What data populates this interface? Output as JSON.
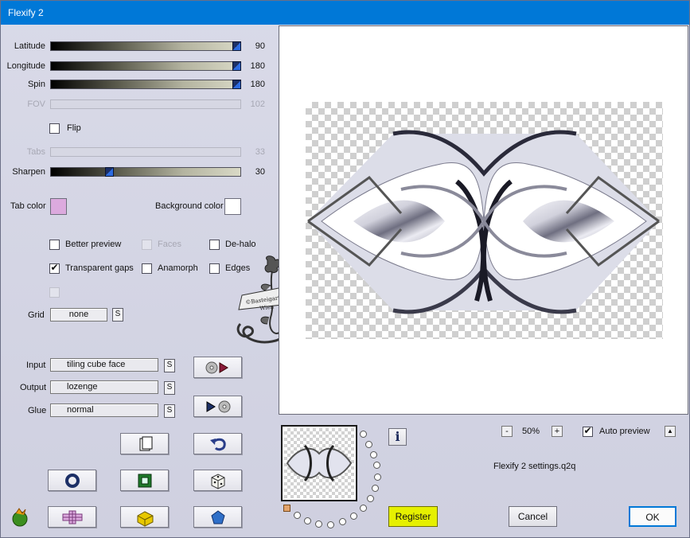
{
  "window": {
    "title": "Flexify 2"
  },
  "sliders": {
    "latitude": {
      "label": "Latitude",
      "value": "90",
      "fraction": 1.0
    },
    "longitude": {
      "label": "Longitude",
      "value": "180",
      "fraction": 1.0
    },
    "spin": {
      "label": "Spin",
      "value": "180",
      "fraction": 1.0
    },
    "fov": {
      "label": "FOV",
      "value": "102",
      "disabled": true
    },
    "tabs": {
      "label": "Tabs",
      "value": "33",
      "disabled": true
    },
    "sharpen": {
      "label": "Sharpen",
      "value": "30",
      "fraction": 0.3
    }
  },
  "options": {
    "flip": {
      "label": "Flip",
      "checked": false
    },
    "better_preview": {
      "label": "Better preview",
      "checked": false
    },
    "faces": {
      "label": "Faces",
      "checked": false,
      "disabled": true
    },
    "de_halo": {
      "label": "De-halo",
      "checked": false
    },
    "transparent_gaps": {
      "label": "Transparent gaps",
      "checked": true
    },
    "anamorph": {
      "label": "Anamorph",
      "checked": false
    },
    "edges": {
      "label": "Edges",
      "checked": false
    }
  },
  "colors": {
    "tab_color_label": "Tab color",
    "tab_color": "#dcaade",
    "background_color_label": "Background color",
    "background_color": "#ffffff"
  },
  "grid": {
    "label": "Grid",
    "value": "none",
    "s_label": "S"
  },
  "mapping": {
    "input_label": "Input",
    "input_value": "tiling cube face",
    "output_label": "Output",
    "output_value": "lozenge",
    "glue_label": "Glue",
    "glue_value": "normal",
    "s_label": "S"
  },
  "watermark": {
    "text": "©Basteigarten Wien"
  },
  "zoom": {
    "level": "50%",
    "minus": "-",
    "plus": "+"
  },
  "auto_preview": {
    "label": "Auto preview",
    "checked": true,
    "arrow": "▲"
  },
  "preset": {
    "filename": "Flexify 2 settings.q2q"
  },
  "buttons": {
    "register": "Register",
    "cancel": "Cancel",
    "ok": "OK",
    "info": "i"
  },
  "accent": {
    "titlebar": "#0078d7",
    "register": "#e6f000"
  }
}
